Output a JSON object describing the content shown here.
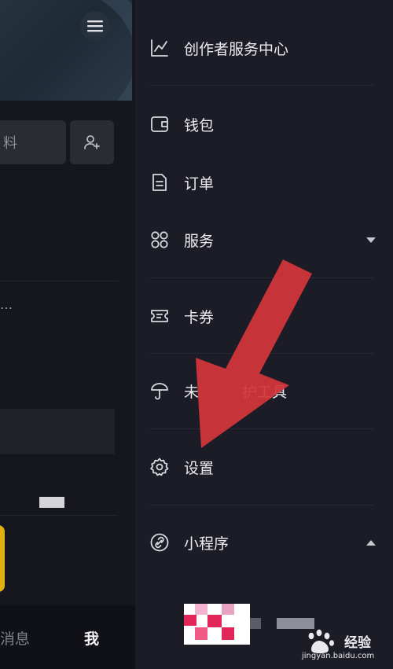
{
  "left": {
    "edit_label": "料",
    "ellipsis": "…",
    "nav": {
      "messages": "消息",
      "me": "我"
    }
  },
  "drawer": {
    "items": [
      {
        "label": "创作者服务中心",
        "icon": "chart-icon"
      },
      {
        "label": "钱包",
        "icon": "wallet-icon"
      },
      {
        "label": "订单",
        "icon": "order-doc-icon"
      },
      {
        "label": "服务",
        "icon": "services-grid-icon",
        "expand": "collapsed"
      },
      {
        "label": "卡券",
        "icon": "ticket-icon"
      },
      {
        "label": "未",
        "label_tail": "护工具",
        "icon": "umbrella-icon"
      },
      {
        "label": "设置",
        "icon": "settings-gear-icon"
      },
      {
        "label": "小程序",
        "icon": "mini-program-link-icon",
        "expand": "expanded"
      }
    ]
  },
  "watermark": {
    "text": "经验",
    "url": "jingyan.baidu.com"
  },
  "colors": {
    "drawer_bg": "#1b1c26",
    "arrow": "#d3353a",
    "accent_yellow": "#e4b00f"
  }
}
